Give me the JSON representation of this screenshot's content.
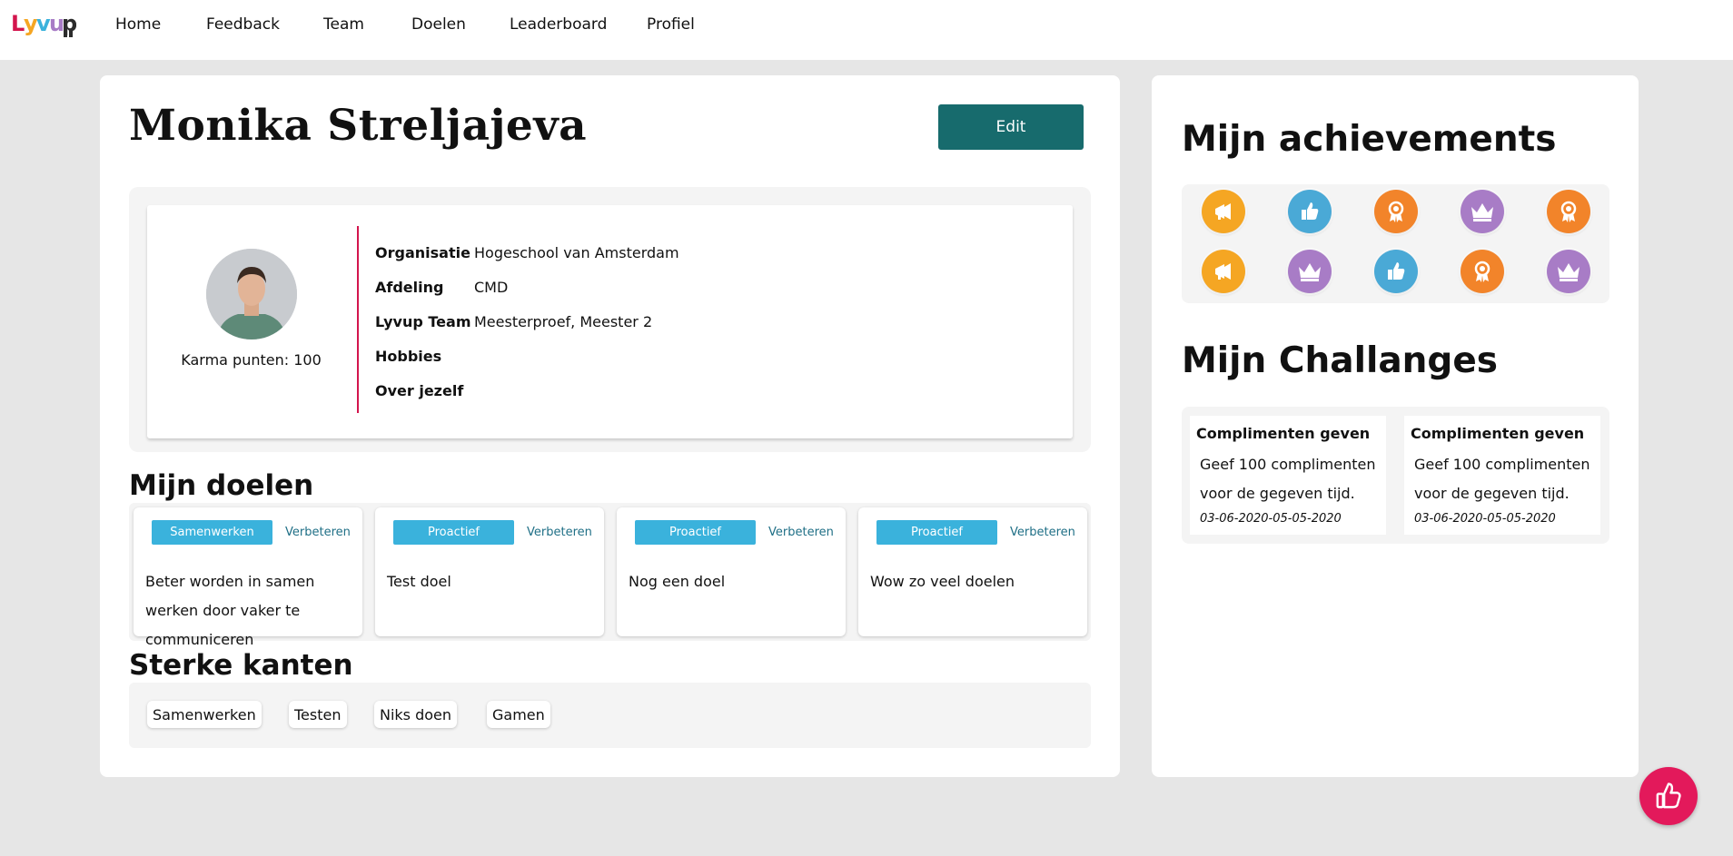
{
  "nav": {
    "logo_text": "Lyvup",
    "items": [
      {
        "label": "Home"
      },
      {
        "label": "Feedback"
      },
      {
        "label": "Team"
      },
      {
        "label": "Doelen"
      },
      {
        "label": "Leaderboard"
      },
      {
        "label": "Profiel"
      }
    ]
  },
  "profile": {
    "name": "Monika Streljajeva",
    "edit_label": "Edit",
    "karma": "Karma punten: 100",
    "fields": [
      {
        "label": "Organisatie",
        "value": "Hogeschool van Amsterdam"
      },
      {
        "label": "Afdeling",
        "value": "CMD"
      },
      {
        "label": "Lyvup Team",
        "value": "Meesterproef, Meester 2"
      },
      {
        "label": "Hobbies",
        "value": ""
      },
      {
        "label": "Over jezelf",
        "value": ""
      }
    ]
  },
  "goals": {
    "title": "Mijn doelen",
    "items": [
      {
        "tag": "Samenwerken",
        "link": "Verbeteren",
        "text": "Beter worden in samen werken door vaker te communiceren"
      },
      {
        "tag": "Proactief",
        "link": "Verbeteren",
        "text": "Test doel"
      },
      {
        "tag": "Proactief",
        "link": "Verbeteren",
        "text": "Nog een doel"
      },
      {
        "tag": "Proactief",
        "link": "Verbeteren",
        "text": "Wow zo veel doelen"
      }
    ]
  },
  "strengths": {
    "title": "Sterke kanten",
    "items": [
      "Samenwerken",
      "Testen",
      "Niks doen",
      "Gamen"
    ]
  },
  "achievements": {
    "title": "Mijn achievements",
    "badges": [
      {
        "icon": "megaphone-icon",
        "color": "#f5a623"
      },
      {
        "icon": "thumbs-up-icon",
        "color": "#4aa9d6"
      },
      {
        "icon": "medal-icon",
        "color": "#f2842a"
      },
      {
        "icon": "crown-icon",
        "color": "#a87cc6"
      },
      {
        "icon": "medal-icon",
        "color": "#f2842a"
      },
      {
        "icon": "megaphone-icon",
        "color": "#f5a623"
      },
      {
        "icon": "crown-icon",
        "color": "#a87cc6"
      },
      {
        "icon": "thumbs-up-icon",
        "color": "#4aa9d6"
      },
      {
        "icon": "medal-icon",
        "color": "#f2842a"
      },
      {
        "icon": "crown-icon",
        "color": "#a87cc6"
      }
    ]
  },
  "challenges": {
    "title": "Mijn Challanges",
    "items": [
      {
        "title": "Complimenten geven",
        "desc": "Geef 100 complimenten voor de gegeven tijd.",
        "dates": "03-06-2020-05-05-2020"
      },
      {
        "title": "Complimenten geven",
        "desc": "Geef 100 complimenten voor de gegeven tijd.",
        "dates": "03-06-2020-05-05-2020"
      }
    ]
  },
  "fab": {
    "icon": "thumbs-up-icon"
  },
  "colors": {
    "accent_teal": "#176b6d",
    "accent_blue": "#3ab2dc",
    "accent_red": "#e3195b"
  }
}
